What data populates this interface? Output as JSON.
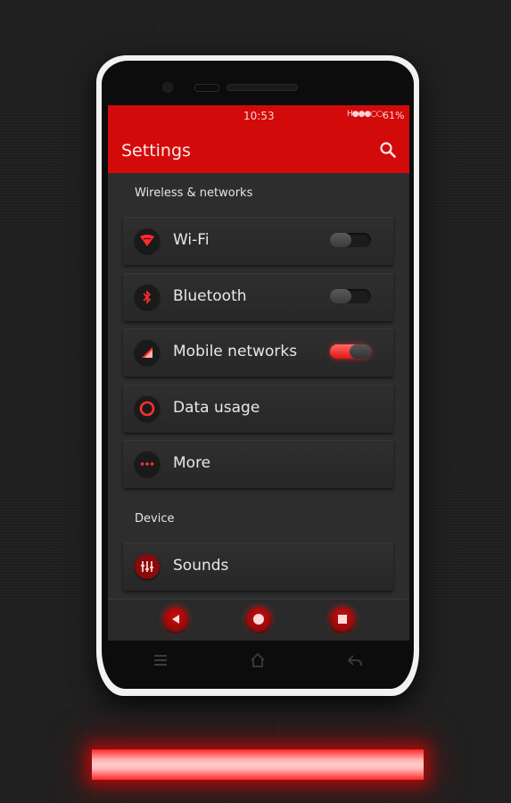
{
  "status_bar": {
    "time": "10:53",
    "signal": "H●●●○○",
    "battery": "61%"
  },
  "app_bar": {
    "title": "Settings",
    "search_icon": "search-icon"
  },
  "sections": [
    {
      "header": "Wireless & networks",
      "items": [
        {
          "label": "Wi-Fi",
          "icon": "wifi-icon",
          "toggle": false
        },
        {
          "label": "Bluetooth",
          "icon": "bluetooth-icon",
          "toggle": false
        },
        {
          "label": "Mobile networks",
          "icon": "mobile-signal-icon",
          "toggle": true
        },
        {
          "label": "Data usage",
          "icon": "data-usage-icon"
        },
        {
          "label": "More",
          "icon": "more-dots-icon"
        }
      ]
    },
    {
      "header": "Device",
      "items": [
        {
          "label": "Sounds",
          "icon": "sound-equalizer-icon"
        }
      ]
    }
  ],
  "nav_bar": {
    "buttons": [
      "back-icon",
      "home-icon",
      "recents-icon"
    ]
  },
  "hardware_keys": [
    "menu-icon",
    "home-icon",
    "back-icon"
  ],
  "colors": {
    "accent": "#d20a0a",
    "glow": "#ff2a2a",
    "card": "#2b2b2b"
  }
}
